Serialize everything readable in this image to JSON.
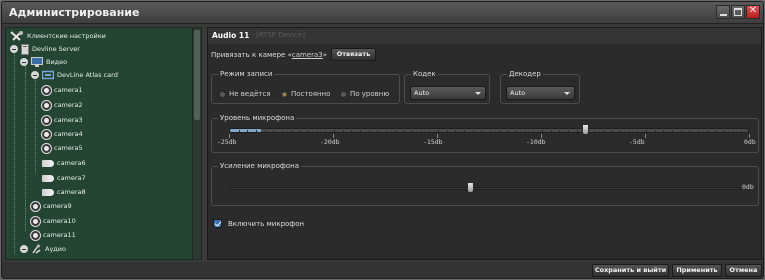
{
  "window": {
    "title": "Администрирование"
  },
  "tree": {
    "items": [
      {
        "label": "Клиентские настройки",
        "level": 0,
        "icon": "tools-icon"
      },
      {
        "label": "Devline Server",
        "level": 0,
        "icon": "server-icon"
      },
      {
        "label": "Видео",
        "level": 1,
        "icon": "monitor-icon"
      },
      {
        "label": "DevLine Atlas card",
        "level": 2,
        "icon": "capture-card-icon"
      },
      {
        "label": "camera1",
        "level": 3,
        "icon": "camera-icon"
      },
      {
        "label": "camera2",
        "level": 3,
        "icon": "camera-icon"
      },
      {
        "label": "camera3",
        "level": 3,
        "icon": "camera-icon"
      },
      {
        "label": "camera4",
        "level": 3,
        "icon": "camera-icon"
      },
      {
        "label": "camera5",
        "level": 3,
        "icon": "camera-icon"
      },
      {
        "label": "camera6",
        "level": 3,
        "icon": "ptz-camera-icon"
      },
      {
        "label": "camera7",
        "level": 3,
        "icon": "ptz-camera-icon"
      },
      {
        "label": "camera8",
        "level": 3,
        "icon": "ptz-camera-icon"
      },
      {
        "label": "camera9",
        "level": 2,
        "icon": "camera-icon"
      },
      {
        "label": "camera10",
        "level": 2,
        "icon": "camera-icon"
      },
      {
        "label": "camera11",
        "level": 2,
        "icon": "camera-icon"
      },
      {
        "label": "Аудио",
        "level": 1,
        "icon": "audio-icon"
      }
    ]
  },
  "device": {
    "title": "Audio 11",
    "subtitle": "[RTSP Device]"
  },
  "binding": {
    "prefix": "Привязать к камере «",
    "camera": "camera3",
    "suffix": "»",
    "unbind_label": "Отвязать"
  },
  "recording": {
    "title": "Режим записи",
    "options": [
      "Не ведётся",
      "Постоянно",
      "По уровню"
    ],
    "selected": "Постоянно"
  },
  "codec": {
    "title": "Кодек",
    "value": "Auto"
  },
  "decoder": {
    "title": "Декодер",
    "value": "Auto"
  },
  "mic_level": {
    "title": "Уровень микрофона",
    "scale": [
      "-25db",
      "-20db",
      "-15db",
      "-10db",
      "-5db",
      "0db"
    ],
    "value_db": -5,
    "meter_fraction": 0.06
  },
  "mic_gain": {
    "title": "Усиление микрофона",
    "scale_end": "0db",
    "fraction": 0.47
  },
  "enable_mic": {
    "label": "Включить микрофон",
    "checked": true
  },
  "footer": {
    "save_exit": "Сохранить и выйти",
    "apply": "Применить",
    "cancel": "Отмена"
  },
  "colors": {
    "accent": "#7fa8c8",
    "tree_bg": "#244434",
    "panel_bg": "#2b2b2b"
  }
}
